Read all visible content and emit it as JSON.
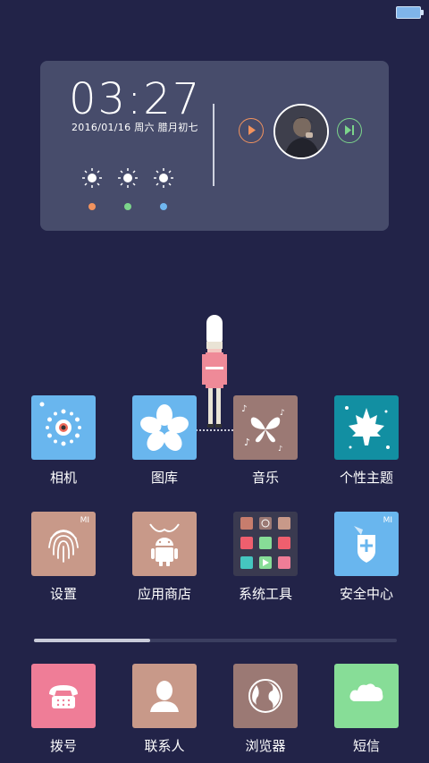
{
  "status": {
    "battery_icon": "battery-icon"
  },
  "widget": {
    "time": "03:27",
    "date": "2016/01/16  周六  腊月初七",
    "weather_dot_colors": [
      "#f2935e",
      "#7cd58b",
      "#70b7f0"
    ],
    "play_color": "#f2935e",
    "next_color": "#7cd58b"
  },
  "apps_row1": [
    {
      "label": "相机",
      "color": "#69b6ee"
    },
    {
      "label": "图库",
      "color": "#69b6ee"
    },
    {
      "label": "音乐",
      "color": "#9b7974"
    },
    {
      "label": "个性主题",
      "color": "#128fa2"
    }
  ],
  "apps_row2": [
    {
      "label": "设置",
      "color": "#c89989",
      "badge": "MI"
    },
    {
      "label": "应用商店",
      "color": "#c89989"
    },
    {
      "label": "系统工具",
      "color": "#3a3a50"
    },
    {
      "label": "安全中心",
      "color": "#69b6ee",
      "badge": "MI"
    }
  ],
  "dock": [
    {
      "label": "拨号",
      "color": "#ef7d97"
    },
    {
      "label": "联系人",
      "color": "#c89989"
    },
    {
      "label": "浏览器",
      "color": "#9b7974"
    },
    {
      "label": "短信",
      "color": "#87dd97"
    }
  ],
  "pager": {
    "current_page_fraction": 0.32
  }
}
